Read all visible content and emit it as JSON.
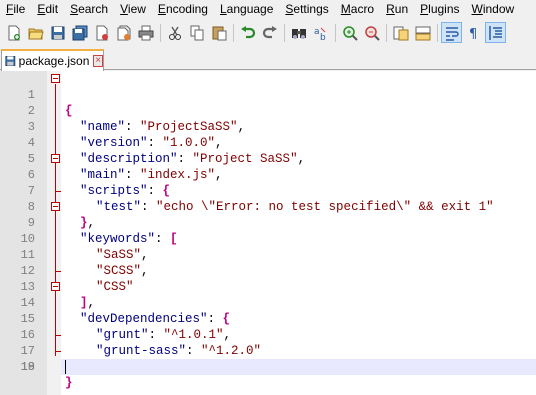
{
  "menu": [
    {
      "label": "File"
    },
    {
      "label": "Edit"
    },
    {
      "label": "Search"
    },
    {
      "label": "View"
    },
    {
      "label": "Encoding"
    },
    {
      "label": "Language"
    },
    {
      "label": "Settings"
    },
    {
      "label": "Macro"
    },
    {
      "label": "Run"
    },
    {
      "label": "Plugins"
    },
    {
      "label": "Window"
    }
  ],
  "toolbar": {
    "icons": [
      "new-file-icon",
      "open-file-icon",
      "save-icon",
      "save-all-icon",
      "close-icon",
      "close-all-icon",
      "print-icon",
      "cut-icon",
      "copy-icon",
      "paste-icon",
      "undo-icon",
      "redo-icon",
      "find-icon",
      "replace-icon",
      "zoom-in-icon",
      "zoom-out-icon",
      "sync-vertical-icon",
      "sync-horizontal-icon",
      "word-wrap-icon",
      "show-all-chars-icon",
      "indent-guide-icon"
    ]
  },
  "tab": {
    "label": "package.json"
  },
  "lines": [
    {
      "n": "1",
      "text": "{"
    },
    {
      "n": "2",
      "text": "\"name\": \"ProjectSaSS\","
    },
    {
      "n": "3",
      "text": "\"version\": \"1.0.0\","
    },
    {
      "n": "4",
      "text": "\"description\": \"Project SaSS\","
    },
    {
      "n": "5",
      "text": "\"main\": \"index.js\","
    },
    {
      "n": "6",
      "text": "\"scripts\": {"
    },
    {
      "n": "7",
      "text": "\"test\": \"echo \\\"Error: no test specified\\\" && exit 1\""
    },
    {
      "n": "8",
      "text": "},"
    },
    {
      "n": "9",
      "text": "\"keywords\": ["
    },
    {
      "n": "10",
      "text": "\"SaSS\","
    },
    {
      "n": "11",
      "text": "\"SCSS\","
    },
    {
      "n": "12",
      "text": "\"CSS\""
    },
    {
      "n": "13",
      "text": "],"
    },
    {
      "n": "14",
      "text": "\"devDependencies\": {"
    },
    {
      "n": "15",
      "text": "\"grunt\": \"^1.0.1\","
    },
    {
      "n": "16",
      "text": "\"grunt-sass\": \"^1.2.0\""
    },
    {
      "n": "17",
      "text": "}"
    },
    {
      "n": "18",
      "text": "}"
    },
    {
      "n": "19",
      "text": ""
    }
  ],
  "colors": {
    "brace": "#c00080",
    "key": "#000080",
    "string": "#800000",
    "current_line": "#e8e8ff",
    "fold": "#c00000"
  }
}
